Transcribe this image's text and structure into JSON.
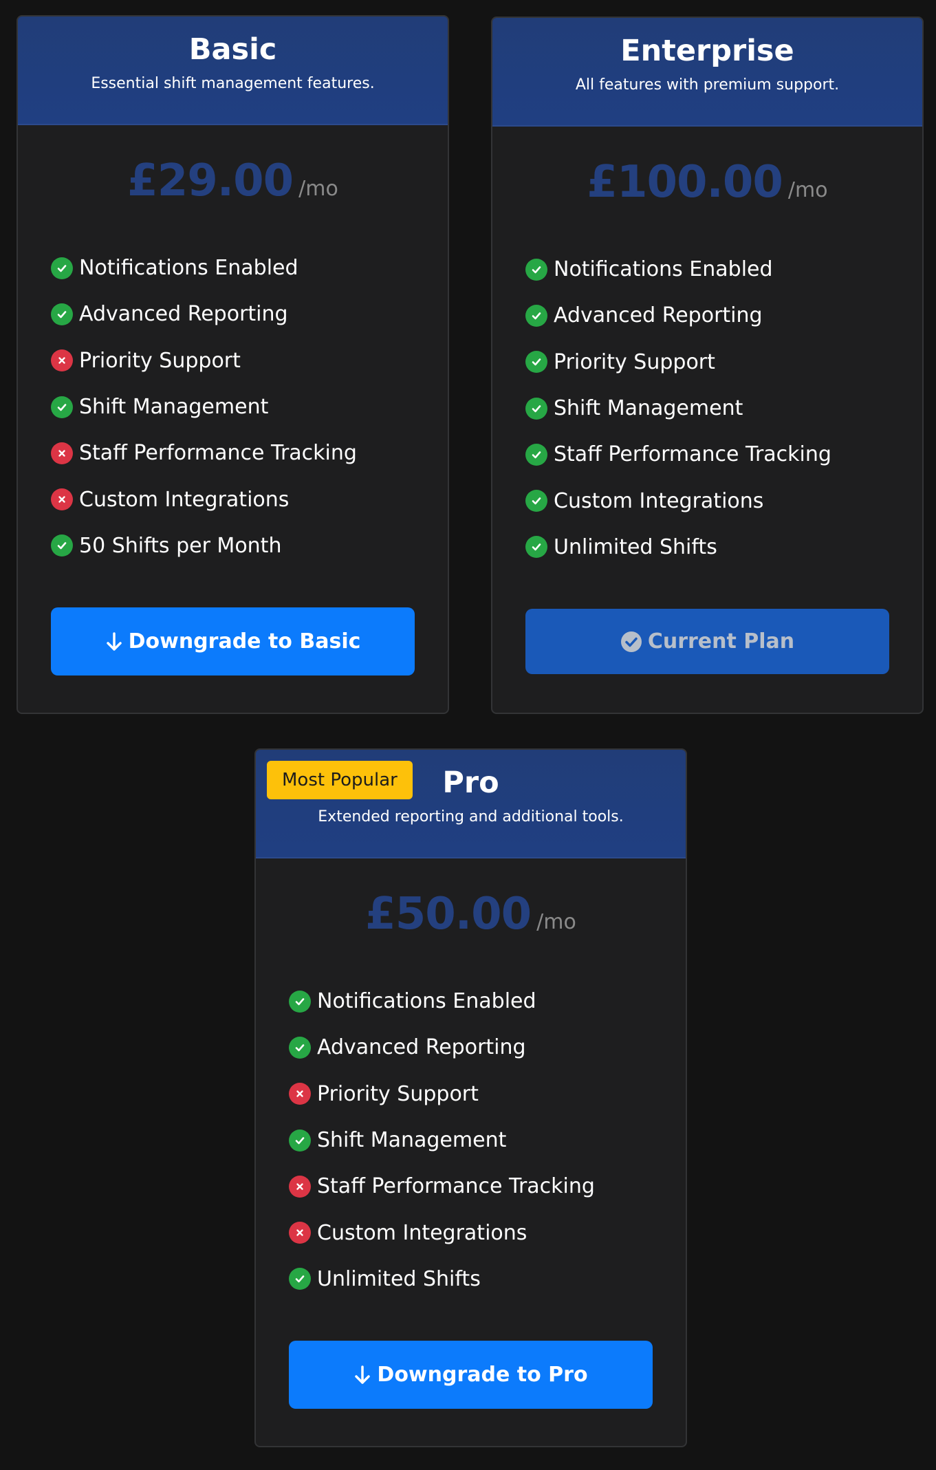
{
  "plans": [
    {
      "name": "Basic",
      "description": "Essential shift management features.",
      "price": "£29.00",
      "period": "/mo",
      "features": [
        {
          "label": "Notifications Enabled",
          "included": true
        },
        {
          "label": "Advanced Reporting",
          "included": true
        },
        {
          "label": "Priority Support",
          "included": false
        },
        {
          "label": "Shift Management",
          "included": true
        },
        {
          "label": "Staff Performance Tracking",
          "included": false
        },
        {
          "label": "Custom Integrations",
          "included": false
        },
        {
          "label": "50 Shifts per Month",
          "included": true
        }
      ],
      "button": {
        "label": "Downgrade to Basic",
        "icon": "arrow-down-icon"
      }
    },
    {
      "name": "Enterprise",
      "description": "All features with premium support.",
      "price": "£100.00",
      "period": "/mo",
      "features": [
        {
          "label": "Notifications Enabled",
          "included": true
        },
        {
          "label": "Advanced Reporting",
          "included": true
        },
        {
          "label": "Priority Support",
          "included": true
        },
        {
          "label": "Shift Management",
          "included": true
        },
        {
          "label": "Staff Performance Tracking",
          "included": true
        },
        {
          "label": "Custom Integrations",
          "included": true
        },
        {
          "label": "Unlimited Shifts",
          "included": true
        }
      ],
      "button": {
        "label": "Current Plan",
        "icon": "check-circle-icon"
      }
    },
    {
      "name": "Pro",
      "badge": "Most Popular",
      "description": "Extended reporting and additional tools.",
      "price": "£50.00",
      "period": "/mo",
      "features": [
        {
          "label": "Notifications Enabled",
          "included": true
        },
        {
          "label": "Advanced Reporting",
          "included": true
        },
        {
          "label": "Priority Support",
          "included": false
        },
        {
          "label": "Shift Management",
          "included": true
        },
        {
          "label": "Staff Performance Tracking",
          "included": false
        },
        {
          "label": "Custom Integrations",
          "included": false
        },
        {
          "label": "Unlimited Shifts",
          "included": true
        }
      ],
      "button": {
        "label": "Downgrade to Pro",
        "icon": "arrow-down-icon"
      }
    }
  ],
  "colors": {
    "background": "#131313",
    "card": "#1e1e1f",
    "header": "#213d78",
    "price": "#24407f",
    "included": "#27a745",
    "excluded": "#dc3545",
    "primary_button": "#0c7bfc",
    "current_button": "#1a59b8",
    "badge": "#fdc10a"
  }
}
